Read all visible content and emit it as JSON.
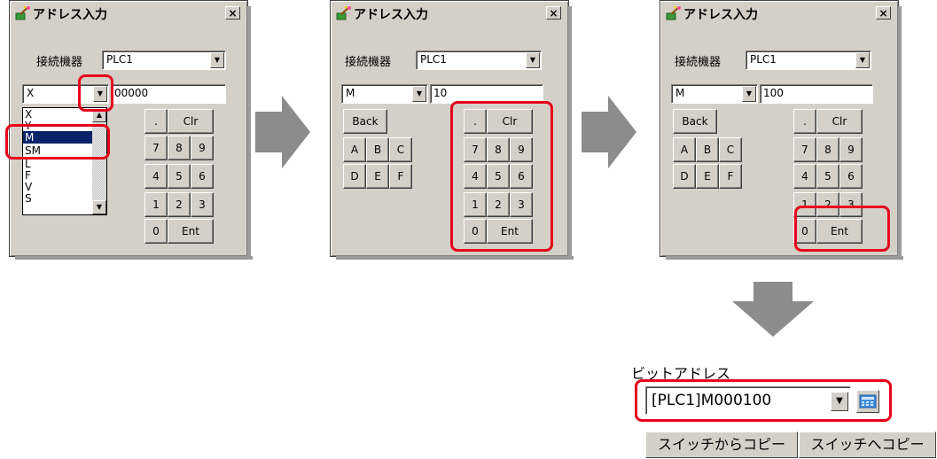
{
  "dialogs": [
    {
      "title": "アドレス入力",
      "close": "×",
      "device_label": "接続機器",
      "device_value": "PLC1",
      "type_value": "X",
      "address_value": "00000",
      "list_items": [
        "X",
        "Y",
        "M",
        "SM",
        "L",
        "F",
        "V",
        "S"
      ],
      "list_selected": "M",
      "keys": {
        "dot": ".",
        "clr": "Clr",
        "k7": "7",
        "k8": "8",
        "k9": "9",
        "k4": "4",
        "k5": "5",
        "k6": "6",
        "k1": "1",
        "k2": "2",
        "k3": "3",
        "k0": "0",
        "ent": "Ent"
      }
    },
    {
      "title": "アドレス入力",
      "close": "×",
      "device_label": "接続機器",
      "device_value": "PLC1",
      "type_value": "M",
      "address_value": "10",
      "keys": {
        "back": "Back",
        "a": "A",
        "b": "B",
        "c": "C",
        "d": "D",
        "e": "E",
        "f": "F",
        "dot": ".",
        "clr": "Clr",
        "k7": "7",
        "k8": "8",
        "k9": "9",
        "k4": "4",
        "k5": "5",
        "k6": "6",
        "k1": "1",
        "k2": "2",
        "k3": "3",
        "k0": "0",
        "ent": "Ent"
      }
    },
    {
      "title": "アドレス入力",
      "close": "×",
      "device_label": "接続機器",
      "device_value": "PLC1",
      "type_value": "M",
      "address_value": "100",
      "keys": {
        "back": "Back",
        "a": "A",
        "b": "B",
        "c": "C",
        "d": "D",
        "e": "E",
        "f": "F",
        "dot": ".",
        "clr": "Clr",
        "k7": "7",
        "k8": "8",
        "k9": "9",
        "k4": "4",
        "k5": "5",
        "k6": "6",
        "k1": "1",
        "k2": "2",
        "k3": "3",
        "k0": "0",
        "ent": "Ent"
      }
    }
  ],
  "result": {
    "label": "ビットアドレス",
    "address_value": "[PLC1]M000100",
    "copy_from_switch": "スイッチからコピー",
    "copy_to_switch": "スイッチへコピー"
  },
  "icons": {
    "app": "wand-icon",
    "dropdown": "chevron-down-icon",
    "calculator": "calculator-icon",
    "step": "arrow-right-icon"
  },
  "colors": {
    "highlight": "#e8001c",
    "dialog_bg": "#d4d0c8",
    "arrow": "#8c8c8c",
    "selection": "#0a246a"
  }
}
